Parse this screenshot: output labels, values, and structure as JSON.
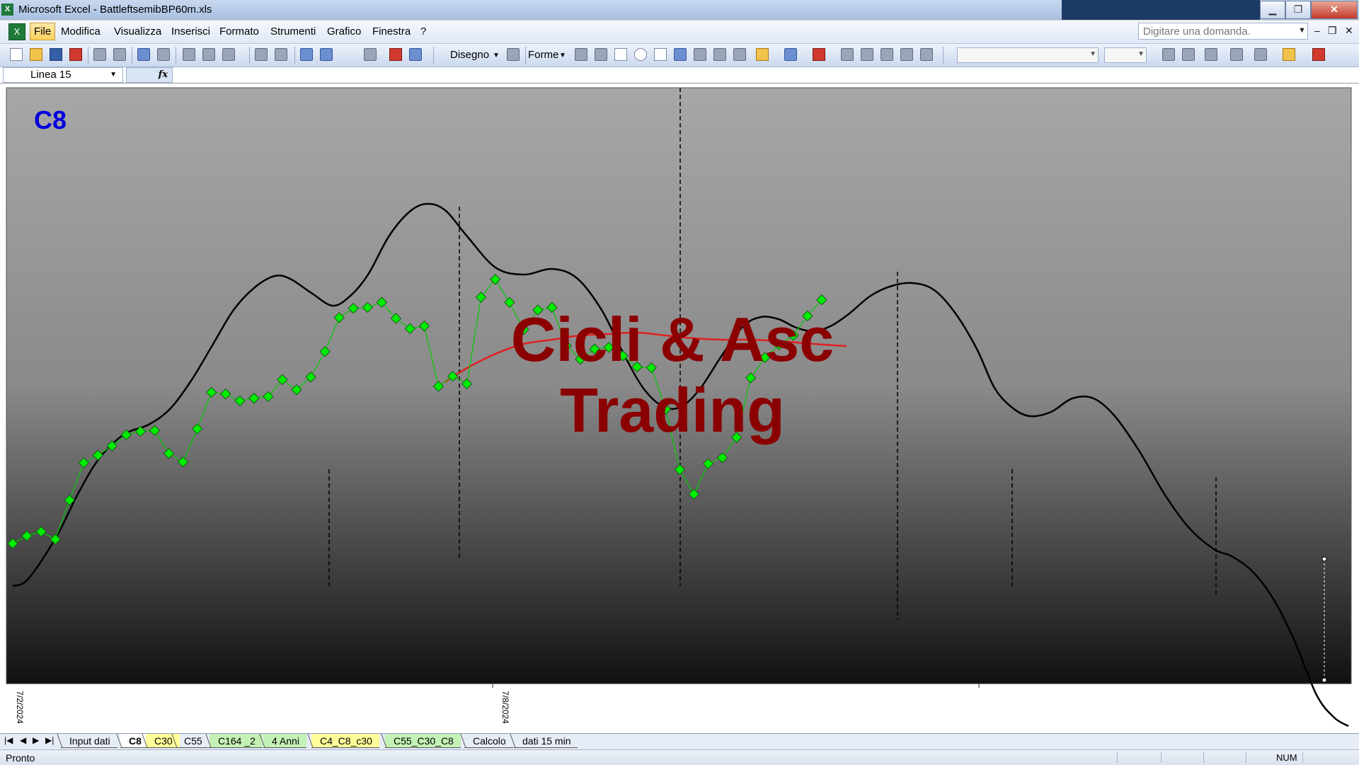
{
  "window": {
    "title": "Microsoft Excel - BattleftsemibBP60m.xls",
    "app_icon": "excel-icon",
    "buttons": [
      "minimize-icon",
      "restore-icon",
      "close-icon"
    ]
  },
  "menu": {
    "items": [
      "File",
      "Modifica",
      "Visualizza",
      "Inserisci",
      "Formato",
      "Strumenti",
      "Grafico",
      "Finestra",
      "?"
    ],
    "ask_placeholder": "Digitare una domanda."
  },
  "toolbar": {
    "disegno_label": "Disegno",
    "forme_label": "Forme"
  },
  "formula_bar": {
    "name_box": "Linea 15",
    "fx_label": "fx"
  },
  "chart": {
    "label": "C8",
    "watermark_line1": "Cicli & Asc",
    "watermark_line2": "Trading",
    "x_tick_labels": [
      "7/2/2024",
      "7/8/2024"
    ],
    "colors": {
      "label": "#0000dd",
      "watermark": "#8b0000",
      "cycle_line": "#000000",
      "price_line": "#00cc00",
      "marker": "#00ee00",
      "average_line": "#e02020"
    },
    "price_values": [
      0.65,
      0.74,
      0.79,
      0.7,
      1.16,
      1.6,
      1.69,
      1.8,
      1.93,
      1.97,
      1.98,
      1.71,
      1.61,
      2.0,
      2.43,
      2.41,
      2.33,
      2.36,
      2.38,
      2.58,
      2.46,
      2.61,
      2.91,
      3.31,
      3.42,
      3.43,
      3.49,
      3.3,
      3.18,
      3.21,
      2.5,
      2.62,
      2.53,
      3.55,
      3.76,
      3.49,
      3.17,
      3.4,
      3.43,
      2.98,
      2.82,
      2.94,
      2.96,
      2.86,
      2.73,
      2.72,
      2.23,
      1.52,
      1.23,
      1.59,
      1.66,
      1.9,
      2.6,
      2.84,
      2.99,
      3.1,
      3.33,
      3.52
    ]
  },
  "sheet_tabs": [
    {
      "label": "Input dati",
      "style": "white"
    },
    {
      "label": "C8",
      "style": "selected"
    },
    {
      "label": "C30",
      "style": "yellow"
    },
    {
      "label": "C55",
      "style": "white"
    },
    {
      "label": "C164 _2",
      "style": "green"
    },
    {
      "label": "4 Anni",
      "style": "green"
    },
    {
      "label": "C4_C8_c30",
      "style": "yellow"
    },
    {
      "label": "C55_C30_C8",
      "style": "green"
    },
    {
      "label": "Calcolo",
      "style": "white"
    },
    {
      "label": "dati 15 min",
      "style": "white"
    }
  ],
  "status": {
    "ready": "Pronto",
    "num": "NUM"
  }
}
